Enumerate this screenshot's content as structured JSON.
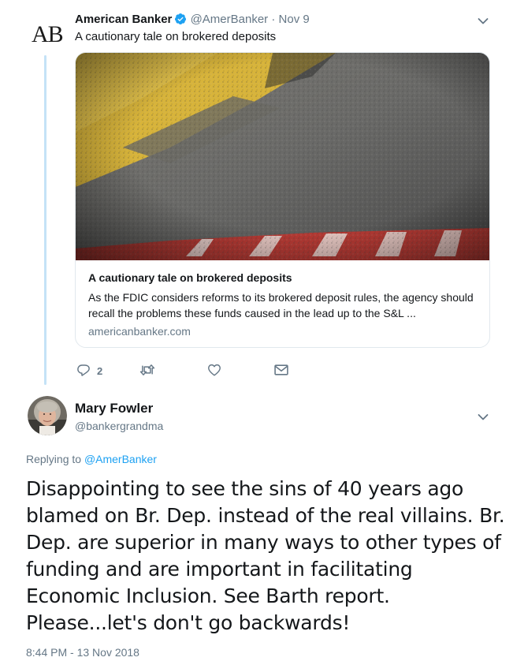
{
  "parent_tweet": {
    "logo_text": "AB",
    "author_name": "American Banker",
    "verified_icon": "verified-badge-icon",
    "handle": "@AmerBanker",
    "separator": "·",
    "date": "Nov 9",
    "text": "A cautionary tale on brokered deposits",
    "card": {
      "title": "A cautionary tale on brokered deposits",
      "description": "As the FDIC considers reforms to its brokered deposit rules, the agency should recall the problems these funds caused in the lead up to the S&L ...",
      "domain": "americanbanker.com"
    },
    "actions": {
      "reply_count": "2"
    }
  },
  "reply_tweet": {
    "author_name": "Mary Fowler",
    "handle": "@bankergrandma",
    "replying_prefix": "Replying to",
    "replying_to": "@AmerBanker",
    "text": "Disappointing to see the sins of 40 years ago blamed on Br. Dep. instead of the real villains. Br. Dep. are superior in many ways to other types of funding and are important in facilitating Economic Inclusion. See Barth report.  Please...let's don't go backwards!",
    "timestamp": "8:44 PM - 13 Nov 2018"
  },
  "colors": {
    "link": "#1da1f2",
    "muted": "#657786",
    "thread_line": "#c4e2f7",
    "border": "#e1e8ed"
  }
}
